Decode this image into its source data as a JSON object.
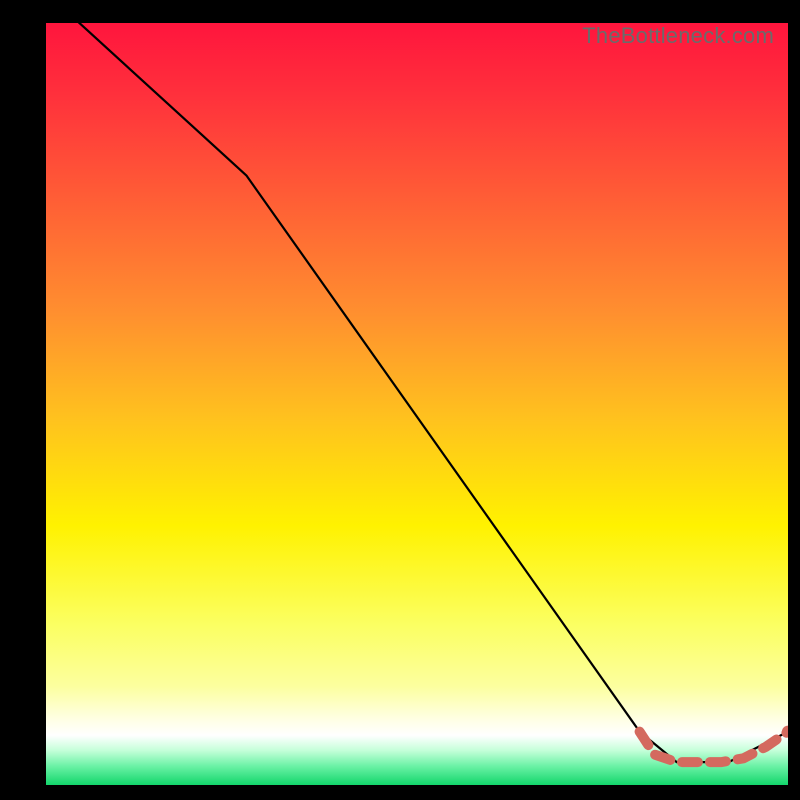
{
  "watermark": "TheBottleneck.com",
  "colors": {
    "bg": "#000000",
    "gradient_top": "#ff153d",
    "gradient_mid_warm": "#ffa531",
    "gradient_yellow": "#fff200",
    "gradient_pale": "#fcff9e",
    "gradient_white": "#ffffff",
    "gradient_mint": "#9effc6",
    "gradient_green": "#13d66b",
    "line": "#000000",
    "dashed": "#d46a5f",
    "dot": "#d46a5f"
  },
  "chart_data": {
    "type": "line",
    "title": "",
    "xlabel": "",
    "ylabel": "",
    "xlim": [
      0,
      100
    ],
    "ylim": [
      0,
      100
    ],
    "series": [
      {
        "name": "curve",
        "style": "solid",
        "x": [
          0,
          27,
          80,
          85,
          92,
          100
        ],
        "y": [
          104,
          80,
          7,
          3,
          3,
          7
        ]
      },
      {
        "name": "floor-dashed",
        "style": "dashed",
        "x": [
          80,
          82,
          85,
          88,
          91,
          94,
          97,
          100
        ],
        "y": [
          7,
          4,
          3,
          3,
          3,
          3.5,
          5,
          7
        ]
      }
    ],
    "end_dot": {
      "x": 100,
      "y": 7
    }
  }
}
